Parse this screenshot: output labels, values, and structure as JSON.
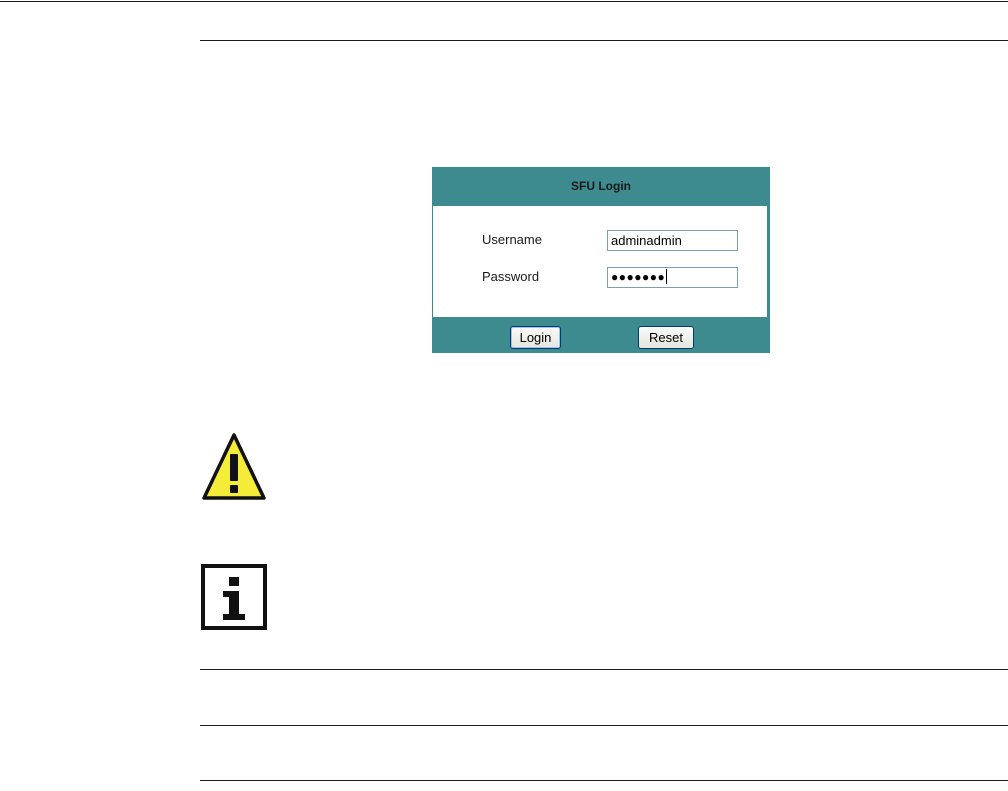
{
  "login": {
    "title": "SFU Login",
    "username_label": "Username",
    "username_value": "adminadmin",
    "password_label": "Password",
    "password_masked": "●●●●●●●",
    "login_button": "Login",
    "reset_button": "Reset"
  },
  "icons": {
    "warning": "warning-icon",
    "info": "info-icon"
  },
  "colors": {
    "panel": "#3d8b8f",
    "warning_fill": "#f5ec3a",
    "text": "#1a1a1a"
  }
}
